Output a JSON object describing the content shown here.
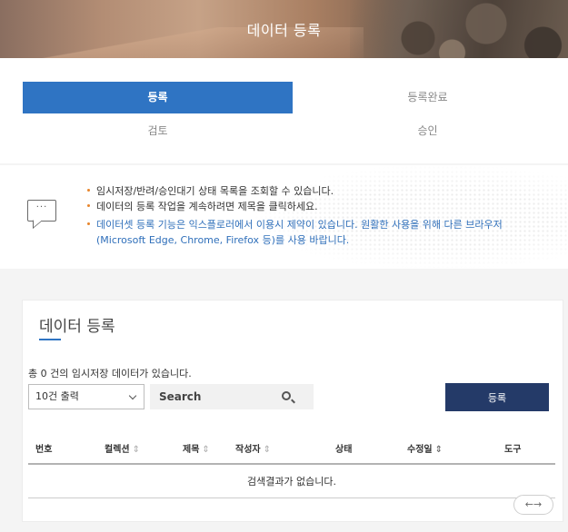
{
  "hero": {
    "title": "데이터 등록"
  },
  "steps": [
    {
      "label": "등록",
      "active": true
    },
    {
      "label": "등록완료",
      "active": false
    },
    {
      "label": "검토",
      "active": false
    },
    {
      "label": "승인",
      "active": false
    }
  ],
  "notice": {
    "icon": "speech-bubble-icon",
    "bubble_text": "···",
    "items": [
      "임시저장/반려/승인대기 상태 목록을 조회할 수 있습니다.",
      "데이터의 등록 작업을 계속하려면 제목을 클릭하세요.",
      "데이터셋 등록 기능은 익스플로러에서 이용시 제약이 있습니다. 원활한 사용을 위해 다른 브라우저 (Microsoft Edge, Chrome, Firefox 등)를 사용 바랍니다."
    ],
    "accent_color": "#e7852b",
    "warning_color": "#2f6fba"
  },
  "panel": {
    "title": "데이터 등록",
    "count_text": "총 0 건의 임시저장 데이터가 있습니다.",
    "page_size_select": "10건 출력",
    "search_placeholder": "Search",
    "register_button": "등록",
    "columns": [
      {
        "label": "번호",
        "sort": ""
      },
      {
        "label": "컬렉션",
        "sort": "⇕"
      },
      {
        "label": "제목",
        "sort": "⇕"
      },
      {
        "label": "작성자",
        "sort": "⇕"
      },
      {
        "label": "상태",
        "sort": ""
      },
      {
        "label": "수정일",
        "sort": "⇕"
      },
      {
        "label": "도구",
        "sort": ""
      }
    ],
    "empty_message": "검색결과가 없습니다.",
    "scroll_hint": "←→"
  },
  "colors": {
    "primary": "#2f74c3",
    "button_dark": "#243a68"
  }
}
